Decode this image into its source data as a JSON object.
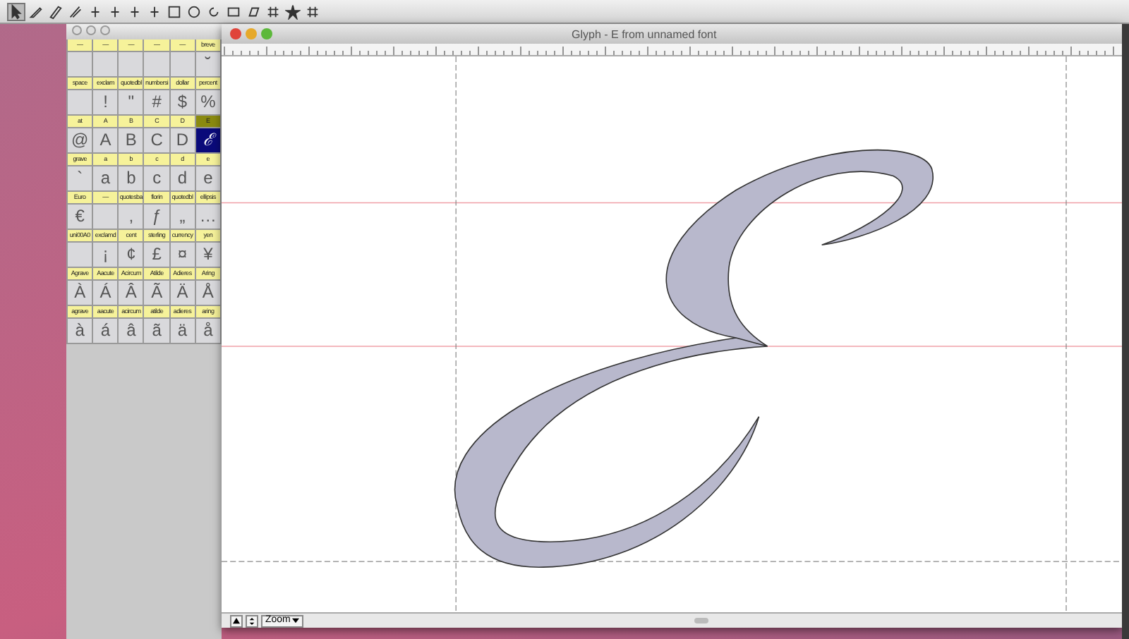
{
  "toolbar": {
    "tools": [
      {
        "kind": "pointer",
        "selected": true
      },
      {
        "kind": "knife",
        "selected": false
      },
      {
        "kind": "pen",
        "selected": false
      },
      {
        "kind": "pencil",
        "selected": false
      },
      {
        "kind": "point",
        "selected": false
      },
      {
        "kind": "point",
        "selected": false
      },
      {
        "kind": "point",
        "selected": false
      },
      {
        "kind": "point",
        "selected": false
      },
      {
        "kind": "rect",
        "selected": false
      },
      {
        "kind": "ellipse",
        "selected": false
      },
      {
        "kind": "rotate",
        "selected": false
      },
      {
        "kind": "scale",
        "selected": false
      },
      {
        "kind": "skew",
        "selected": false
      },
      {
        "kind": "grid",
        "selected": false
      },
      {
        "kind": "star",
        "selected": false
      },
      {
        "kind": "grid",
        "selected": false
      }
    ]
  },
  "font_window": {
    "cells": [
      {
        "label": "—",
        "selected": false
      },
      {
        "label": "—",
        "selected": false
      },
      {
        "label": "—",
        "selected": false
      },
      {
        "label": "—",
        "selected": false
      },
      {
        "label": "—",
        "selected": false
      },
      {
        "label": "breve",
        "glyph": "˘",
        "selected": false
      },
      {
        "label": "space",
        "selected": false
      },
      {
        "label": "exclam",
        "glyph": "!",
        "selected": false
      },
      {
        "label": "quotedbl",
        "glyph": "\"",
        "selected": false
      },
      {
        "label": "numbersi",
        "glyph": "#",
        "selected": false
      },
      {
        "label": "dollar",
        "glyph": "$",
        "selected": false
      },
      {
        "label": "percent",
        "glyph": "%",
        "selected": false
      },
      {
        "label": "at",
        "glyph": "@",
        "selected": false
      },
      {
        "label": "A",
        "glyph": "A",
        "selected": false
      },
      {
        "label": "B",
        "glyph": "B",
        "selected": false
      },
      {
        "label": "C",
        "glyph": "C",
        "selected": false
      },
      {
        "label": "D",
        "glyph": "D",
        "selected": false
      },
      {
        "label": "E",
        "glyph": "ℰ",
        "selected": true
      },
      {
        "label": "grave",
        "glyph": "`",
        "selected": false
      },
      {
        "label": "a",
        "glyph": "a",
        "selected": false
      },
      {
        "label": "b",
        "glyph": "b",
        "selected": false
      },
      {
        "label": "c",
        "glyph": "c",
        "selected": false
      },
      {
        "label": "d",
        "glyph": "d",
        "selected": false
      },
      {
        "label": "e",
        "glyph": "e",
        "selected": false
      },
      {
        "label": "Euro",
        "glyph": "€",
        "selected": false
      },
      {
        "label": "—",
        "selected": false
      },
      {
        "label": "quotesba",
        "glyph": "‚",
        "selected": false
      },
      {
        "label": "florin",
        "glyph": "ƒ",
        "selected": false
      },
      {
        "label": "quotedbl",
        "glyph": "„",
        "selected": false
      },
      {
        "label": "ellipsis",
        "glyph": "…",
        "selected": false
      },
      {
        "label": "uni00A0",
        "selected": false
      },
      {
        "label": "exclamd",
        "glyph": "¡",
        "selected": false
      },
      {
        "label": "cent",
        "glyph": "¢",
        "selected": false
      },
      {
        "label": "sterling",
        "glyph": "£",
        "selected": false
      },
      {
        "label": "currency",
        "glyph": "¤",
        "selected": false
      },
      {
        "label": "yen",
        "glyph": "¥",
        "selected": false
      },
      {
        "label": "Agrave",
        "glyph": "À",
        "selected": false
      },
      {
        "label": "Aacute",
        "glyph": "Á",
        "selected": false
      },
      {
        "label": "Acircum",
        "glyph": "Â",
        "selected": false
      },
      {
        "label": "Atilde",
        "glyph": "Ã",
        "selected": false
      },
      {
        "label": "Adieres",
        "glyph": "Ä",
        "selected": false
      },
      {
        "label": "Aring",
        "glyph": "Å",
        "selected": false
      },
      {
        "label": "agrave",
        "glyph": "à",
        "selected": false
      },
      {
        "label": "aacute",
        "glyph": "á",
        "selected": false
      },
      {
        "label": "acircum",
        "glyph": "â",
        "selected": false
      },
      {
        "label": "atilde",
        "glyph": "ã",
        "selected": false
      },
      {
        "label": "adieres",
        "glyph": "ä",
        "selected": false
      },
      {
        "label": "aring",
        "glyph": "å",
        "selected": false
      }
    ]
  },
  "glyph_window": {
    "title": "Glyph - E from unnamed font",
    "zoom_button": "Zoom"
  }
}
